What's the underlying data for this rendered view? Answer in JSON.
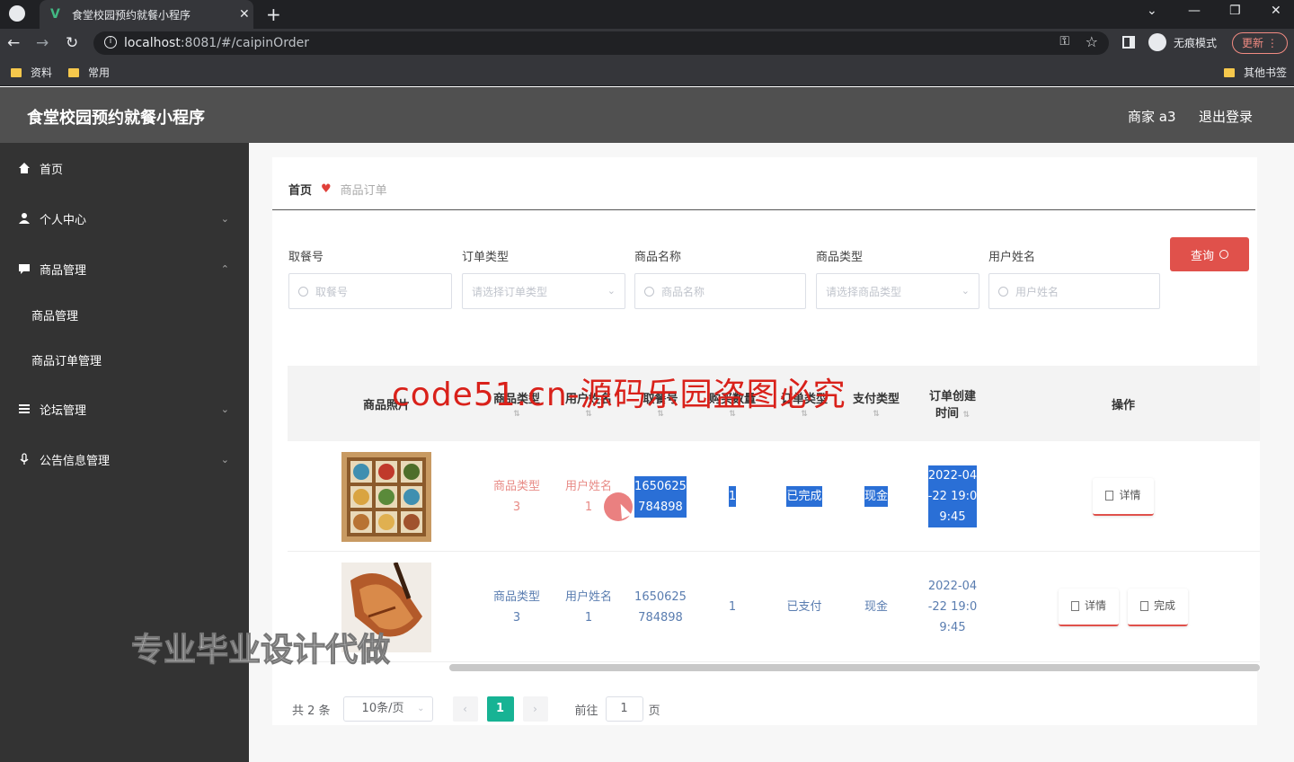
{
  "browser": {
    "tab_title": "食堂校园预约就餐小程序",
    "url_host": "localhost",
    "url_rest": ":8081/#/caipinOrder",
    "incognito_label": "无痕模式",
    "update_label": "更新",
    "bookmarks": [
      "资料",
      "常用"
    ],
    "other_bookmarks": "其他书签"
  },
  "header": {
    "title": "食堂校园预约就餐小程序",
    "user": "商家 a3",
    "logout": "退出登录"
  },
  "sidebar": {
    "items": [
      {
        "label": "首页",
        "icon": "home-icon"
      },
      {
        "label": "个人中心",
        "icon": "user-icon"
      },
      {
        "label": "商品管理",
        "icon": "chat-icon"
      },
      {
        "label": "论坛管理",
        "icon": "list-icon"
      },
      {
        "label": "公告信息管理",
        "icon": "mic-icon"
      }
    ],
    "sub_items": [
      "商品管理",
      "商品订单管理"
    ]
  },
  "breadcrumb": {
    "home": "首页",
    "current": "商品订单"
  },
  "filters": {
    "labels": [
      "取餐号",
      "订单类型",
      "商品名称",
      "商品类型",
      "用户姓名"
    ],
    "placeholders": [
      "取餐号",
      "请选择订单类型",
      "商品名称",
      "请选择商品类型",
      "用户姓名"
    ],
    "query_button": "查询"
  },
  "table": {
    "headers": [
      "商品照片",
      "商品类型",
      "用户姓名",
      "取餐号",
      "购买数量",
      "订单类型",
      "支付类型",
      "订单创建时间",
      "操作"
    ],
    "header_lines": {
      "created_l1": "订单创建",
      "created_l2": "时间"
    },
    "rows": [
      {
        "type_l1": "商品类型",
        "type_l2": "3",
        "user_l1": "用户姓名",
        "user_l2": "1",
        "code_l1": "1650625",
        "code_l2": "784898",
        "qty": "1",
        "order_type": "已完成",
        "pay_type": "现金",
        "time_l1": "2022-04",
        "time_l2": "-22 19:0",
        "time_l3": "9:45",
        "actions": [
          "详情"
        ]
      },
      {
        "type_l1": "商品类型",
        "type_l2": "3",
        "user_l1": "用户姓名",
        "user_l2": "1",
        "code_l1": "1650625",
        "code_l2": "784898",
        "qty": "1",
        "order_type": "已支付",
        "pay_type": "现金",
        "time_l1": "2022-04",
        "time_l2": "-22 19:0",
        "time_l3": "9:45",
        "actions": [
          "详情",
          "完成"
        ]
      }
    ]
  },
  "pagination": {
    "total": "共 2 条",
    "page_size": "10条/页",
    "current_page": "1",
    "goto_label": "前往",
    "goto_value": "1",
    "page_unit": "页"
  },
  "overlays": {
    "watermark_red": "code51.cn-源码乐园盗图必究",
    "watermark_gray": "专业毕业设计代做"
  },
  "colors": {
    "header_bg": "#505050",
    "sidebar_bg": "#333333",
    "accent_red": "#e0514b",
    "pager_active": "#17b394",
    "selection": "#2a6fd6"
  }
}
